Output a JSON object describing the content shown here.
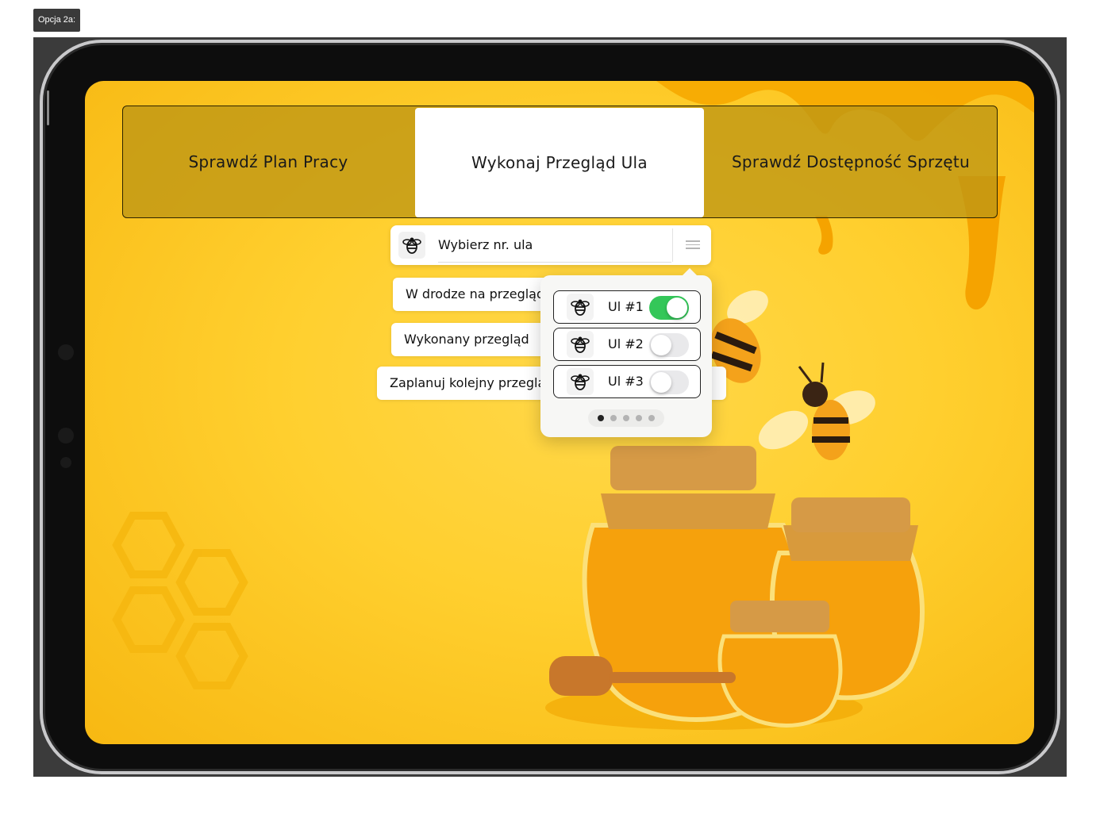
{
  "frame_label": "Opcja 2a:",
  "tabs": [
    {
      "label": "Sprawdź Plan Pracy",
      "active": false
    },
    {
      "label": "Wykonaj Przegląd Ula",
      "active": true
    },
    {
      "label": "Sprawdź Dostępność Sprzętu",
      "active": false
    }
  ],
  "hive_select": {
    "placeholder": "Wybierz nr. ula",
    "icon": "bee-icon",
    "menu_icon": "menu-icon"
  },
  "options": [
    {
      "label": "W drodze na przegląd"
    },
    {
      "label": "Wykonany przegląd"
    },
    {
      "label": "Zaplanuj kolejny przegląd"
    }
  ],
  "hive_list": [
    {
      "label": "Ul #1",
      "enabled": true
    },
    {
      "label": "Ul #2",
      "enabled": false
    },
    {
      "label": "Ul #3",
      "enabled": false
    }
  ],
  "pager": {
    "pages": 5,
    "current": 1
  },
  "colors": {
    "background": "#FFCF2E",
    "toggle_on": "#34C759",
    "tab_bar": "#BE9614"
  }
}
